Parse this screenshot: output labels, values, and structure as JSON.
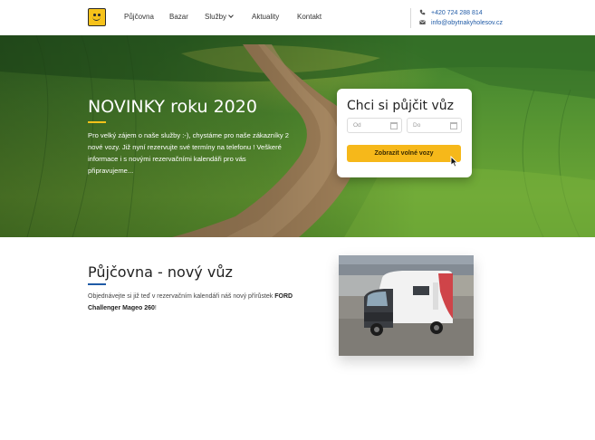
{
  "header": {
    "nav": [
      "Půjčovna",
      "Bazar",
      "Služby",
      "Aktuality",
      "Kontakt"
    ],
    "phone": "+420 724 288 814",
    "email": "info@obytnakyholesov.cz"
  },
  "hero": {
    "title": "NOVINKY roku 2020",
    "text": "Pro velký zájem o naše služby :-), chystáme pro naše zákazníky 2 nové vozy. Již nyní rezervujte své termíny na telefonu ! Veškeré informace i s novými rezervačními kalendáři pro vás připravujeme..."
  },
  "booking": {
    "title": "Chci si půjčit vůz",
    "from_placeholder": "Od",
    "to_placeholder": "Do",
    "button": "Zobrazit volné vozy"
  },
  "section": {
    "title": "Půjčovna - nový vůz",
    "text_before": "Objednávejte si již teď v rezervačním kalendáři náš nový přírůstek ",
    "text_bold": "FORD Challenger Mageo 260",
    "text_after": "!"
  },
  "colors": {
    "accent_yellow": "#f6c21a",
    "accent_blue": "#1f5aa6",
    "button": "#f6b81a"
  },
  "icons": [
    "smiley-logo-icon",
    "chevron-down-icon",
    "phone-icon",
    "envelope-icon",
    "calendar-icon",
    "cursor-icon"
  ]
}
